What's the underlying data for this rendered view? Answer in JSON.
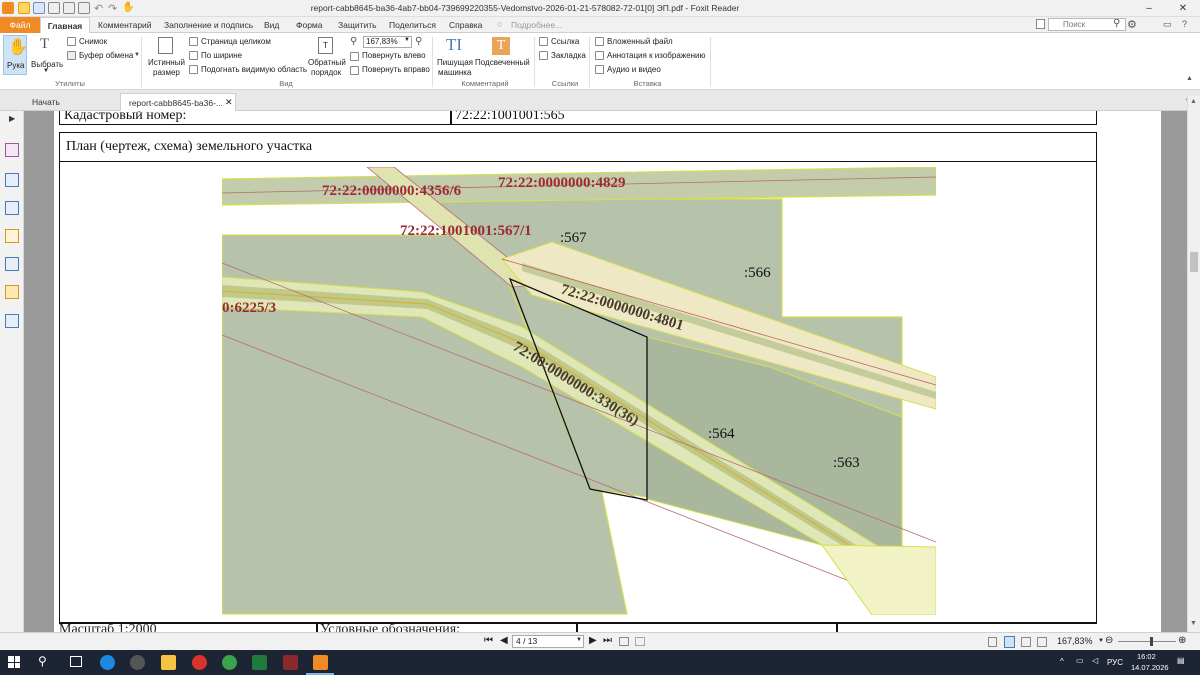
{
  "window": {
    "title": "report-cabb8645-ba36-4ab7-bb04-739699220355-Vedomstvo-2026-01-21-578082-72-01[0] ЭП.pdf - Foxit Reader",
    "search_placeholder": "Поиск"
  },
  "menu": {
    "file": "Файл",
    "tabs": [
      "Главная",
      "Комментарий",
      "Заполнение и подпись",
      "Вид",
      "Форма",
      "Защитить",
      "Поделиться",
      "Справка",
      "Подробнее..."
    ]
  },
  "ribbon": {
    "hand": "Рука",
    "select": "Выбрать",
    "snapshot": "Снимок",
    "clipboard": "Буфер обмена",
    "utilities_group": "Утилиты",
    "actual_size_1": "Истинный",
    "actual_size_2": "размер",
    "fit_page": "Страница целиком",
    "fit_width": "По ширине",
    "fit_visible": "Подогнать видимую область",
    "reverse_1": "Обратный",
    "reverse_2": "порядок",
    "zoom_value": "167,83%",
    "rotate_left": "Повернуть влево",
    "rotate_right": "Повернуть вправо",
    "view_group": "Вид",
    "typewriter_1": "Пишущая",
    "typewriter_2": "машинка",
    "highlight": "Подсвеченный",
    "comment_group": "Комментарий",
    "link": "Ссылка",
    "bookmark": "Закладка",
    "links_group": "Ссылки",
    "attach": "Вложенный файл",
    "image_annot": "Аннотация к изображению",
    "audio_video": "Аудио и видео",
    "insert_group": "Вставка"
  },
  "doc_tabs": {
    "start": "Начать",
    "report": "report-cabb8645-ba36-..."
  },
  "document": {
    "cadastral_label": "Кадастровый номер:",
    "cadastral_value": "72:22:1001001:565",
    "plan_title": "План (чертеж, схема) земельного участка",
    "scale": "Масштаб 1:2000",
    "legend": "Условные обозначения:",
    "map_labels": {
      "l4356": "72:22:0000000:4356/6",
      "l4829": "72:22:0000000:4829",
      "l567_1": "72:22:1001001:567/1",
      "l567": ":567",
      "l566": ":566",
      "l6225": "0:6225/3",
      "l4801": "72:22:0000000:4801",
      "l330": "72:00:0000000:330(36)",
      "l564": ":564",
      "l563": ":563"
    }
  },
  "status": {
    "page_indicator": "4 / 13",
    "zoom": "167,83%"
  },
  "taskbar": {
    "lang": "РУС",
    "time": "16:02",
    "date": "14.07.2026"
  },
  "colors": {
    "accent_orange": "#f08a24",
    "parcel_fill": "#b7c2aa",
    "road_fill": "#eef0c8",
    "taskbar": "#1d2433"
  }
}
